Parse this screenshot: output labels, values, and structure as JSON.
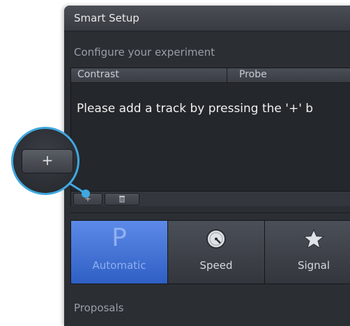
{
  "window": {
    "title": "Smart Setup"
  },
  "section": {
    "configure_label": "Configure your experiment"
  },
  "track_table": {
    "columns": [
      "Contrast",
      "Probe"
    ],
    "empty_message": "Please add a track by pressing the '+' b"
  },
  "track_toolbar": {
    "add_label": "+",
    "delete_icon": "trash-icon"
  },
  "modes": [
    {
      "label": "Automatic",
      "icon": "letter-p-icon",
      "glyph": "P",
      "active": true
    },
    {
      "label": "Speed",
      "icon": "speedometer-icon",
      "active": false
    },
    {
      "label": "Signal",
      "icon": "star-icon",
      "active": false
    }
  ],
  "proposals": {
    "label": "Proposals"
  },
  "colors": {
    "panel_bg": "#2b2e33",
    "accent_blue": "#3fa8e0",
    "active_mode": "#3f6fd6"
  }
}
